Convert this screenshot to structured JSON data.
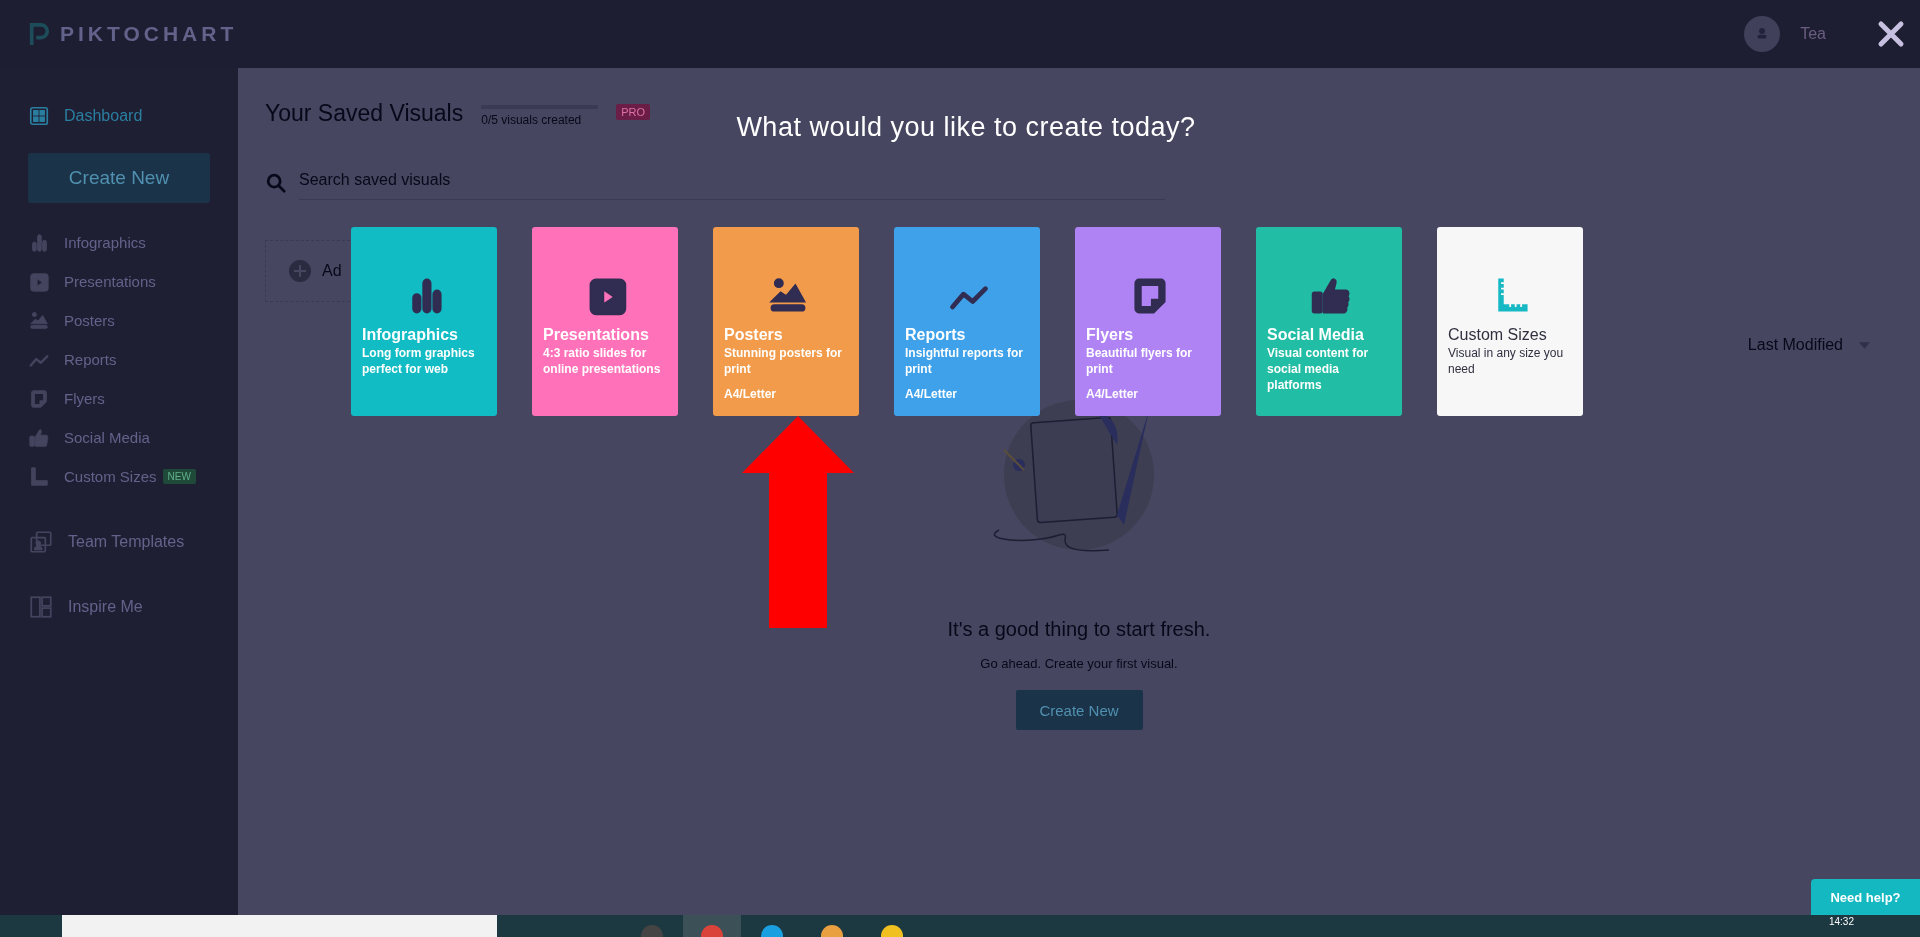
{
  "topbar": {
    "logo": "PIKTOCHART",
    "user_name": "Tea"
  },
  "sidebar": {
    "dashboard": {
      "label": "Dashboard",
      "selected": true
    },
    "create_button": "Create New",
    "types": [
      {
        "label": "Infographics",
        "kind": "bars"
      },
      {
        "label": "Presentations",
        "kind": "slides"
      },
      {
        "label": "Posters",
        "kind": "poster"
      },
      {
        "label": "Reports",
        "kind": "chart"
      },
      {
        "label": "Flyers",
        "kind": "flyer"
      },
      {
        "label": "Social Media",
        "kind": "thumb"
      },
      {
        "label": "Custom Sizes",
        "kind": "ruler",
        "badge": "NEW"
      }
    ],
    "extras": [
      {
        "label": "Team Templates",
        "kind": "team"
      },
      {
        "label": "Inspire Me",
        "kind": "layout"
      }
    ]
  },
  "saved": {
    "title": "Your Saved Visuals",
    "quota": {
      "text": "0/5 visuals created",
      "level": 0
    },
    "badge": "PRO",
    "search": {
      "placeholder": "Search saved visuals"
    },
    "add_button": "Ad",
    "sort": "Last Modified",
    "empty": {
      "heading": "It's a good thing to start fresh.",
      "text": "Go ahead. Create your first visual.",
      "button": "Create New"
    }
  },
  "modal": {
    "title": "What would you like to create today?",
    "cards": [
      {
        "kind": "bars",
        "title": "Infographics",
        "description": "Long form graphics perfect for web",
        "color": "#12bcc4"
      },
      {
        "kind": "slides",
        "title": "Presentations",
        "description": "4:3 ratio slides for online presentations",
        "color": "#ff72b9"
      },
      {
        "kind": "poster",
        "title": "Posters",
        "description": "Stunning posters for print",
        "format": "A4/Letter",
        "color": "#f29b4b"
      },
      {
        "kind": "chart",
        "title": "Reports",
        "description": "Insightful reports for print",
        "format": "A4/Letter",
        "color": "#3ea1ea"
      },
      {
        "kind": "flyer",
        "title": "Flyers",
        "description": "Beautiful flyers for print",
        "format": "A4/Letter",
        "color": "#b083f5"
      },
      {
        "kind": "thumb",
        "title": "Social Media",
        "description": "Visual content for social media platforms",
        "color": "#22bda5"
      },
      {
        "kind": "ruler",
        "title": "Custom Sizes",
        "description": "Visual in any size you need",
        "color": "#f7f7f7"
      }
    ],
    "annotations": [
      {
        "kind": "arrow"
      }
    ]
  },
  "help_button": "Need help?",
  "taskbar": {
    "clock": "14:32"
  }
}
